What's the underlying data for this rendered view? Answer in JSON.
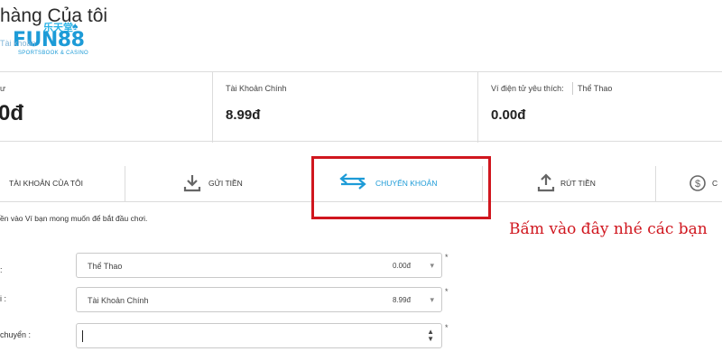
{
  "header": {
    "title": "hàng Của tôi",
    "sub_link": "Tài khoản",
    "logo": {
      "brand": "FUN88",
      "cn": "乐天堂",
      "tagline": "SPORTSBOOK & CASINO",
      "icon": "spade-icon"
    }
  },
  "balances": [
    {
      "label": "ư",
      "value": "0đ"
    },
    {
      "label": "Tài Khoản Chính",
      "value": "8.99đ"
    },
    {
      "label": "Ví điện tử yêu thích:",
      "selected": "Thể Thao",
      "value": "0.00đ"
    }
  ],
  "tabs": [
    {
      "label": "TÀI KHOẢN CỦA TÔI",
      "icon": "user-icon"
    },
    {
      "label": "GỬI TIỀN",
      "icon": "download-icon"
    },
    {
      "label": "CHUYỂN KHOẢN",
      "icon": "transfer-arrows-icon",
      "active": true
    },
    {
      "label": "RÚT TIỀN",
      "icon": "upload-icon"
    },
    {
      "label": "C",
      "icon": "dollar-circle-icon"
    }
  ],
  "instruction": "ền vào Ví bạn mong muốn để bắt đầu chơi.",
  "annotation": "Bấm vào đây nhé các bạn",
  "form": {
    "from": {
      "label": ":",
      "wallet": "Thể Thao",
      "amount": "0.00đ",
      "required": "*"
    },
    "to": {
      "label": "i :",
      "wallet": "Tài Khoản Chính",
      "amount": "8.99đ",
      "required": "*"
    },
    "transfer_amount": {
      "label": "chuyển :",
      "value": "",
      "required": "*"
    }
  },
  "colors": {
    "accent": "#1d9bd7",
    "highlight": "#d0161e"
  }
}
